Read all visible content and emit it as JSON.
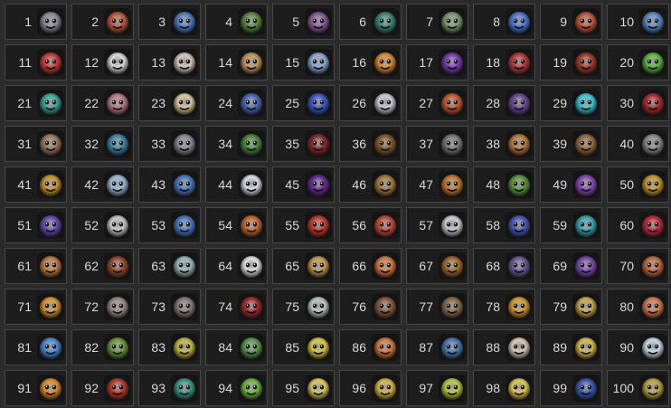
{
  "items": [
    {
      "number": "1",
      "icon": "grey-furry-demon-face-icon",
      "color": "#8a8a9a"
    },
    {
      "number": "2",
      "icon": "multicolor-mask-face-icon",
      "color": "#c0583a"
    },
    {
      "number": "3",
      "icon": "blue-ghost-face-icon",
      "color": "#4f7fc8"
    },
    {
      "number": "4",
      "icon": "green-goblin-face-icon",
      "color": "#5a8a3a"
    },
    {
      "number": "5",
      "icon": "purple-imp-face-icon",
      "color": "#8a5a9a"
    },
    {
      "number": "6",
      "icon": "green-screaming-ghoul-icon",
      "color": "#3a8a7a"
    },
    {
      "number": "7",
      "icon": "green-robot-face-icon",
      "color": "#7a9a6a"
    },
    {
      "number": "8",
      "icon": "blue-crystal-shard-icon",
      "color": "#4a7ad8"
    },
    {
      "number": "9",
      "icon": "red-haired-woman-face-icon",
      "color": "#c8553a"
    },
    {
      "number": "10",
      "icon": "blue-troll-face-icon",
      "color": "#5a8ac8"
    },
    {
      "number": "11",
      "icon": "red-arrow-gem-icon",
      "color": "#d03a3a"
    },
    {
      "number": "12",
      "icon": "white-bird-icon",
      "color": "#d8d8d8"
    },
    {
      "number": "13",
      "icon": "white-ghost-pair-icon",
      "color": "#d8c8b8"
    },
    {
      "number": "14",
      "icon": "blonde-man-face-icon",
      "color": "#c8965a"
    },
    {
      "number": "15",
      "icon": "pale-blue-ghost-woman-icon",
      "color": "#8aa8d8"
    },
    {
      "number": "16",
      "icon": "orange-gem-icon",
      "color": "#e08a2a"
    },
    {
      "number": "17",
      "icon": "purple-gem-icon",
      "color": "#7a3ab8"
    },
    {
      "number": "18",
      "icon": "red-grinning-demon-icon",
      "color": "#b83a3a"
    },
    {
      "number": "19",
      "icon": "red-ogre-face-icon",
      "color": "#a83a2a"
    },
    {
      "number": "20",
      "icon": "green-leaf-creature-icon",
      "color": "#5ab83a"
    },
    {
      "number": "21",
      "icon": "teal-zombie-face-icon",
      "color": "#3aa89a"
    },
    {
      "number": "22",
      "icon": "pink-green-monster-face-icon",
      "color": "#b87a8a"
    },
    {
      "number": "23",
      "icon": "sleeping-old-man-face-icon",
      "color": "#d8c89a"
    },
    {
      "number": "24",
      "icon": "blue-hat-woman-face-icon",
      "color": "#4a6ab8"
    },
    {
      "number": "25",
      "icon": "blue-cyclops-face-icon",
      "color": "#3a5ac8"
    },
    {
      "number": "26",
      "icon": "skeleton-bones-icon",
      "color": "#c8c8d8"
    },
    {
      "number": "27",
      "icon": "red-orange-beast-face-icon",
      "color": "#c85a2a"
    },
    {
      "number": "28",
      "icon": "purple-wizard-face-icon",
      "color": "#6a4a9a"
    },
    {
      "number": "29",
      "icon": "cyan-ice-gem-icon",
      "color": "#3ac8d8"
    },
    {
      "number": "30",
      "icon": "red-armor-figure-icon",
      "color": "#b82a2a"
    },
    {
      "number": "31",
      "icon": "helmeted-goblin-face-icon",
      "color": "#9a7a5a"
    },
    {
      "number": "32",
      "icon": "teal-cap-troll-face-icon",
      "color": "#3a8aa8"
    },
    {
      "number": "33",
      "icon": "grey-stone-golem-icon",
      "color": "#8a8a9a"
    },
    {
      "number": "34",
      "icon": "green-plant-creature-icon",
      "color": "#4a8a3a"
    },
    {
      "number": "35",
      "icon": "dark-red-dragon-icon",
      "color": "#8a2a2a"
    },
    {
      "number": "36",
      "icon": "brown-horse-head-icon",
      "color": "#8a5a2a"
    },
    {
      "number": "37",
      "icon": "grey-rose-tombstone-icon",
      "color": "#7a7a7a"
    },
    {
      "number": "38",
      "icon": "brown-scroll-icon",
      "color": "#b87a3a"
    },
    {
      "number": "39",
      "icon": "brown-shield-icon",
      "color": "#9a6a3a"
    },
    {
      "number": "40",
      "icon": "grey-pause-shield-icon",
      "color": "#8a8a8a"
    },
    {
      "number": "41",
      "icon": "gold-shield-icon",
      "color": "#c8962a"
    },
    {
      "number": "42",
      "icon": "light-blue-crest-icon",
      "color": "#9ab8d8"
    },
    {
      "number": "43",
      "icon": "blue-frost-orb-icon",
      "color": "#4a7ac8"
    },
    {
      "number": "44",
      "icon": "white-skull-icon",
      "color": "#d8d8e8"
    },
    {
      "number": "45",
      "icon": "purple-devil-face-icon",
      "color": "#6a2a9a"
    },
    {
      "number": "46",
      "icon": "brown-mushroom-creature-icon",
      "color": "#a87a3a"
    },
    {
      "number": "47",
      "icon": "orange-horned-mask-icon",
      "color": "#c87a2a"
    },
    {
      "number": "48",
      "icon": "green-frog-face-icon",
      "color": "#5a9a3a"
    },
    {
      "number": "49",
      "icon": "purple-mushroom-icon",
      "color": "#8a4ab8"
    },
    {
      "number": "50",
      "icon": "gold-armored-knight-icon",
      "color": "#c8962a"
    },
    {
      "number": "51",
      "icon": "purple-shadow-figure-icon",
      "color": "#6a4ab8"
    },
    {
      "number": "52",
      "icon": "white-bearded-dwarf-icon",
      "color": "#c8c8c8"
    },
    {
      "number": "53",
      "icon": "blue-wolf-face-icon",
      "color": "#4a7ac8"
    },
    {
      "number": "54",
      "icon": "orange-wild-creature-icon",
      "color": "#c86a2a"
    },
    {
      "number": "55",
      "icon": "red-spiky-hair-face-icon",
      "color": "#c83a2a"
    },
    {
      "number": "56",
      "icon": "red-haired-lady-face-icon",
      "color": "#c84a3a"
    },
    {
      "number": "57",
      "icon": "white-bearded-wizard-icon",
      "color": "#c8c8d8"
    },
    {
      "number": "58",
      "icon": "blue-gold-robot-face-icon",
      "color": "#4a5ab8"
    },
    {
      "number": "59",
      "icon": "teal-hooded-face-icon",
      "color": "#3aa8b8"
    },
    {
      "number": "60",
      "icon": "red-demon-hair-face-icon",
      "color": "#c82a3a"
    },
    {
      "number": "61",
      "icon": "orange-green-elf-face-icon",
      "color": "#c87a3a"
    },
    {
      "number": "62",
      "icon": "brown-monkey-face-icon",
      "color": "#9a4a2a"
    },
    {
      "number": "63",
      "icon": "stone-slab-icon",
      "color": "#9ab8b8"
    },
    {
      "number": "64",
      "icon": "white-jar-icon",
      "color": "#e0e0e0"
    },
    {
      "number": "65",
      "icon": "gold-halo-face-icon",
      "color": "#c89a4a"
    },
    {
      "number": "66",
      "icon": "orange-haired-hero-face-icon",
      "color": "#d87a3a"
    },
    {
      "number": "67",
      "icon": "brown-lion-face-icon",
      "color": "#a86a2a"
    },
    {
      "number": "68",
      "icon": "purple-skull-face-icon",
      "color": "#6a5a9a"
    },
    {
      "number": "69",
      "icon": "purple-beast-face-icon",
      "color": "#7a4ab8"
    },
    {
      "number": "70",
      "icon": "brown-haired-woman-face-icon",
      "color": "#c86a3a"
    },
    {
      "number": "71",
      "icon": "orange-witch-hat-icon",
      "color": "#d8962a"
    },
    {
      "number": "72",
      "icon": "grey-troll-grin-icon",
      "color": "#9a8a8a"
    },
    {
      "number": "73",
      "icon": "grey-ape-face-icon",
      "color": "#8a7a7a"
    },
    {
      "number": "74",
      "icon": "red-monster-mouth-icon",
      "color": "#a82a2a"
    },
    {
      "number": "75",
      "icon": "white-mushroom-shield-icon",
      "color": "#b8c8b8"
    },
    {
      "number": "76",
      "icon": "brown-boar-face-icon",
      "color": "#8a5a3a"
    },
    {
      "number": "77",
      "icon": "bearded-man-face-icon",
      "color": "#8a6a4a"
    },
    {
      "number": "78",
      "icon": "gold-ring-icon",
      "color": "#d89a2a"
    },
    {
      "number": "79",
      "icon": "gold-helmet-knight-icon",
      "color": "#c8a84a"
    },
    {
      "number": "80",
      "icon": "orange-haired-girl-face-icon",
      "color": "#d87a4a"
    },
    {
      "number": "81",
      "icon": "blue-laughing-face-icon",
      "color": "#4a8ad8"
    },
    {
      "number": "82",
      "icon": "green-goblin-grin-icon",
      "color": "#6a9a3a"
    },
    {
      "number": "83",
      "icon": "yellow-purple-jester-face-icon",
      "color": "#c8b83a"
    },
    {
      "number": "84",
      "icon": "green-screaming-monster-icon",
      "color": "#5a9a4a"
    },
    {
      "number": "85",
      "icon": "yellow-cube-face-icon",
      "color": "#d8c83a"
    },
    {
      "number": "86",
      "icon": "orange-facepalm-face-icon",
      "color": "#d87a3a"
    },
    {
      "number": "87",
      "icon": "blue-troll-laugh-icon",
      "color": "#4a7ab8"
    },
    {
      "number": "88",
      "icon": "white-hand-face-icon",
      "color": "#d8c8b8"
    },
    {
      "number": "89",
      "icon": "blonde-woman-face-icon",
      "color": "#d8b84a"
    },
    {
      "number": "90",
      "icon": "white-hair-woman-face-icon",
      "color": "#c8d8e8"
    },
    {
      "number": "91",
      "icon": "orange-laughing-face-icon",
      "color": "#e08a2a"
    },
    {
      "number": "92",
      "icon": "red-brute-face-icon",
      "color": "#b83a2a"
    },
    {
      "number": "93",
      "icon": "teal-grumpy-face-icon",
      "color": "#3a9a8a"
    },
    {
      "number": "94",
      "icon": "green-vomit-face-icon",
      "color": "#6ab83a"
    },
    {
      "number": "95",
      "icon": "yellow-sleeping-face-icon",
      "color": "#d8c85a"
    },
    {
      "number": "96",
      "icon": "yellow-shocked-face-icon",
      "color": "#d8b83a"
    },
    {
      "number": "97",
      "icon": "yellow-green-grin-face-icon",
      "color": "#b8c83a"
    },
    {
      "number": "98",
      "icon": "yellow-smiling-face-icon",
      "color": "#e0c84a"
    },
    {
      "number": "99",
      "icon": "blue-gold-knight-face-icon",
      "color": "#3a5ab8"
    },
    {
      "number": "100",
      "icon": "yellow-green-dragon-icon",
      "color": "#b8a83a"
    }
  ]
}
